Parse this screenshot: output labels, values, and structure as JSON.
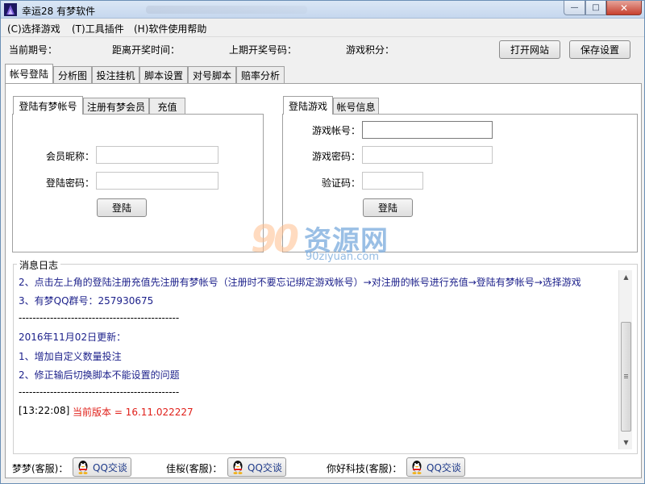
{
  "window": {
    "title": "幸运28 有梦软件",
    "controls": {
      "minimize": "—",
      "maximize": "□",
      "close": "✕"
    }
  },
  "menu": [
    {
      "label": "(C)选择游戏"
    },
    {
      "label": "(T)工具插件"
    },
    {
      "label": "(H)软件使用帮助"
    }
  ],
  "info": {
    "current_period": "当前期号：",
    "countdown": "距离开奖时间：",
    "last_number": "上期开奖号码：",
    "game_points": "游戏积分：",
    "open_site_button": "打开网站",
    "save_settings_button": "保存设置"
  },
  "tabs": [
    {
      "label": "帐号登陆",
      "active": true
    },
    {
      "label": "分析图"
    },
    {
      "label": "投注挂机"
    },
    {
      "label": "脚本设置"
    },
    {
      "label": "对号脚本"
    },
    {
      "label": "赔率分析"
    }
  ],
  "left_panel": {
    "tabs": [
      {
        "label": "登陆有梦帐号",
        "active": true
      },
      {
        "label": "注册有梦会员"
      },
      {
        "label": "充值"
      }
    ],
    "nickname_label": "会员昵称：",
    "password_label": "登陆密码：",
    "login_button": "登陆"
  },
  "right_panel": {
    "tabs": [
      {
        "label": "登陆游戏",
        "active": true
      },
      {
        "label": "帐号信息"
      }
    ],
    "account_label": "游戏帐号：",
    "password_label": "游戏密码：",
    "captcha_label": "验证码：",
    "login_button": "登陆"
  },
  "watermark": {
    "digits": "90",
    "brand": "资源网",
    "url": "90ziyuan.com"
  },
  "log": {
    "title": "消息日志",
    "lines": [
      {
        "text": "2、点击左上角的登陆注册充值先注册有梦帐号（注册时不要忘记绑定游戏帐号）→对注册的帐号进行充值→登陆有梦帐号→选择游戏",
        "color": "#1b1f8a"
      },
      {
        "text": "3、有梦QQ群号：257930675",
        "color": "#1b1f8a"
      },
      {
        "text": "----------------------------------------------",
        "color": "#000000"
      },
      {
        "text": "2016年11月02日更新：",
        "color": "#1b1f8a"
      },
      {
        "text": "1、增加自定义数量投注",
        "color": "#1b1f8a"
      },
      {
        "text": "2、修正输后切换脚本不能设置的问题",
        "color": "#1b1f8a"
      },
      {
        "text": "----------------------------------------------",
        "color": "#000000"
      }
    ],
    "last_time": "[13:22:08]",
    "last_message": "当前版本 = 16.11.022227",
    "last_message_color": "#e0201a"
  },
  "footer": {
    "service": [
      {
        "name": "梦梦(客服)：",
        "button": "QQ交谈"
      },
      {
        "name": "佳桜(客服)：",
        "button": "QQ交谈"
      },
      {
        "name": "你好科技(客服)：",
        "button": "QQ交谈"
      }
    ]
  },
  "colors": {
    "log_text": "#1b1f8a",
    "log_highlight": "#e0201a",
    "titlebar": "#c5d7ee"
  }
}
